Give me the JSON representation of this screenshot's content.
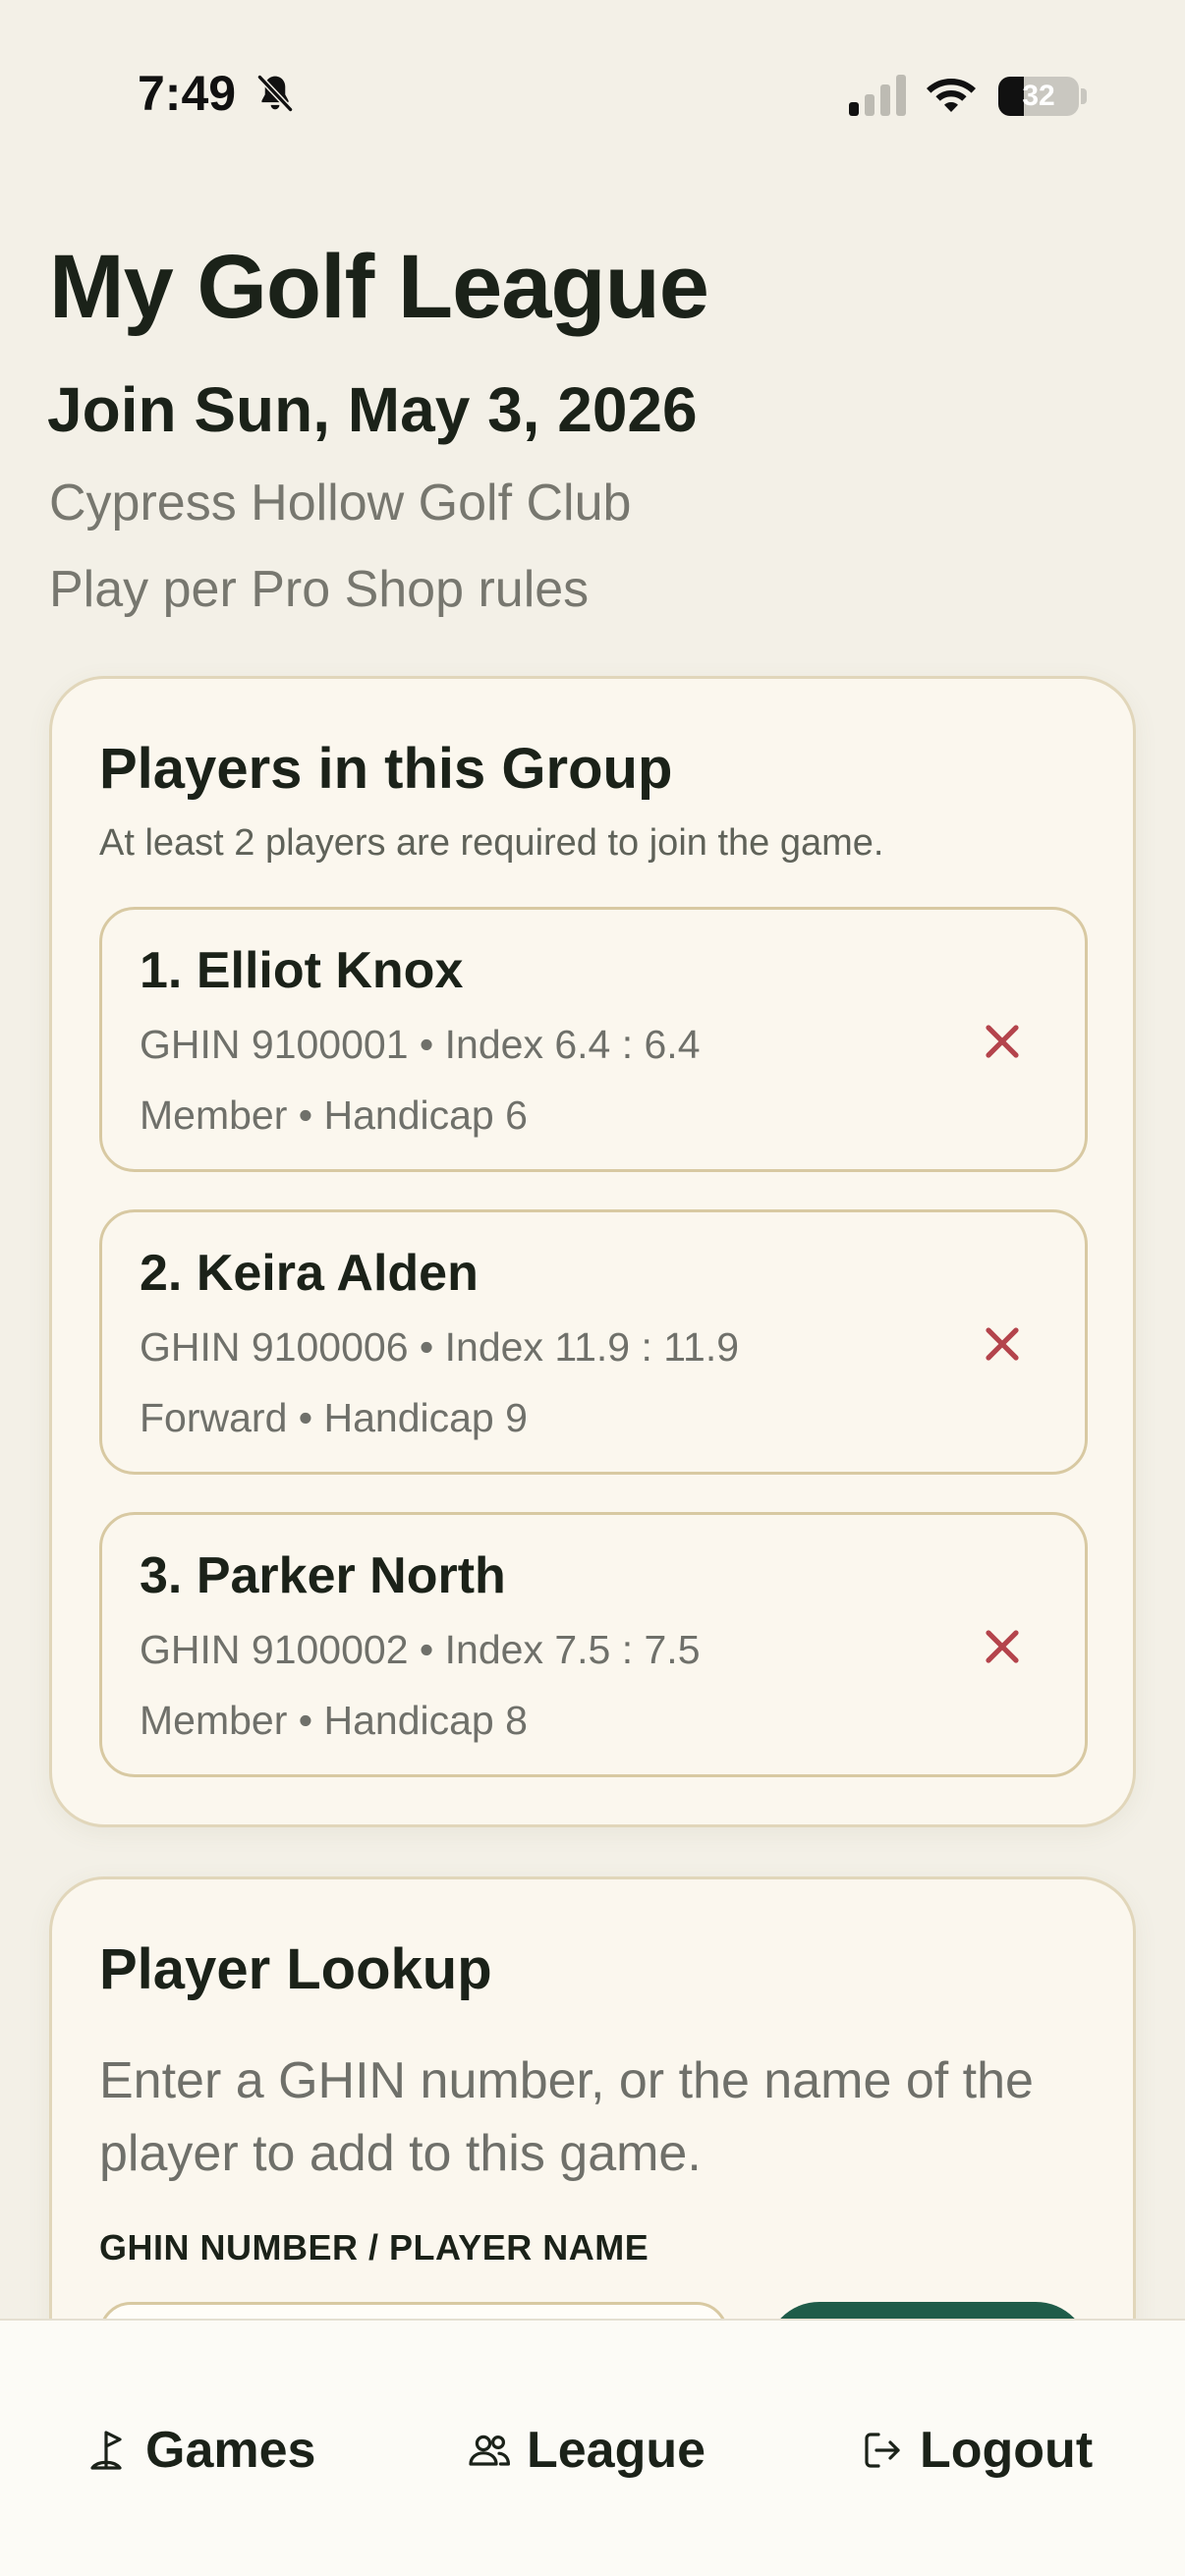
{
  "status_bar": {
    "time": "7:49",
    "battery_level": 32,
    "battery_text": "32"
  },
  "header": {
    "title": "My Golf League",
    "join_date": "Join Sun, May 3, 2026",
    "club": "Cypress Hollow Golf Club",
    "rules": "Play per Pro Shop rules"
  },
  "group": {
    "title": "Players in this Group",
    "subtitle": "At least 2 players are required to join the game.",
    "players": [
      {
        "name": "1. Elliot Knox",
        "line1": "GHIN 9100001 • Index 6.4 : 6.4",
        "line2": "Member • Handicap 6"
      },
      {
        "name": "2. Keira Alden",
        "line1": "GHIN 9100006 • Index 11.9 : 11.9",
        "line2": "Forward • Handicap 9"
      },
      {
        "name": "3. Parker North",
        "line1": "GHIN 9100002 • Index 7.5 : 7.5",
        "line2": "Member • Handicap 8"
      }
    ]
  },
  "lookup": {
    "title": "Player Lookup",
    "description": "Enter a GHIN number, or the name of the player to add to this game.",
    "field_label": "GHIN NUMBER / PLAYER NAME"
  },
  "nav": {
    "games": "Games",
    "league": "League",
    "logout": "Logout"
  },
  "colors": {
    "background": "#f3f0e7",
    "card": "#fbf7ee",
    "card_border": "#e1d6ba",
    "text": "#1b2219",
    "muted": "#77776f",
    "remove": "#b4444c",
    "accent": "#1f5c49"
  },
  "icons": {
    "status": [
      "bell-slash-icon",
      "cellular-signal-icon",
      "wifi-icon",
      "battery-icon"
    ],
    "remove": "close-icon",
    "nav": [
      "golf-flag-icon",
      "users-icon",
      "logout-icon"
    ]
  }
}
